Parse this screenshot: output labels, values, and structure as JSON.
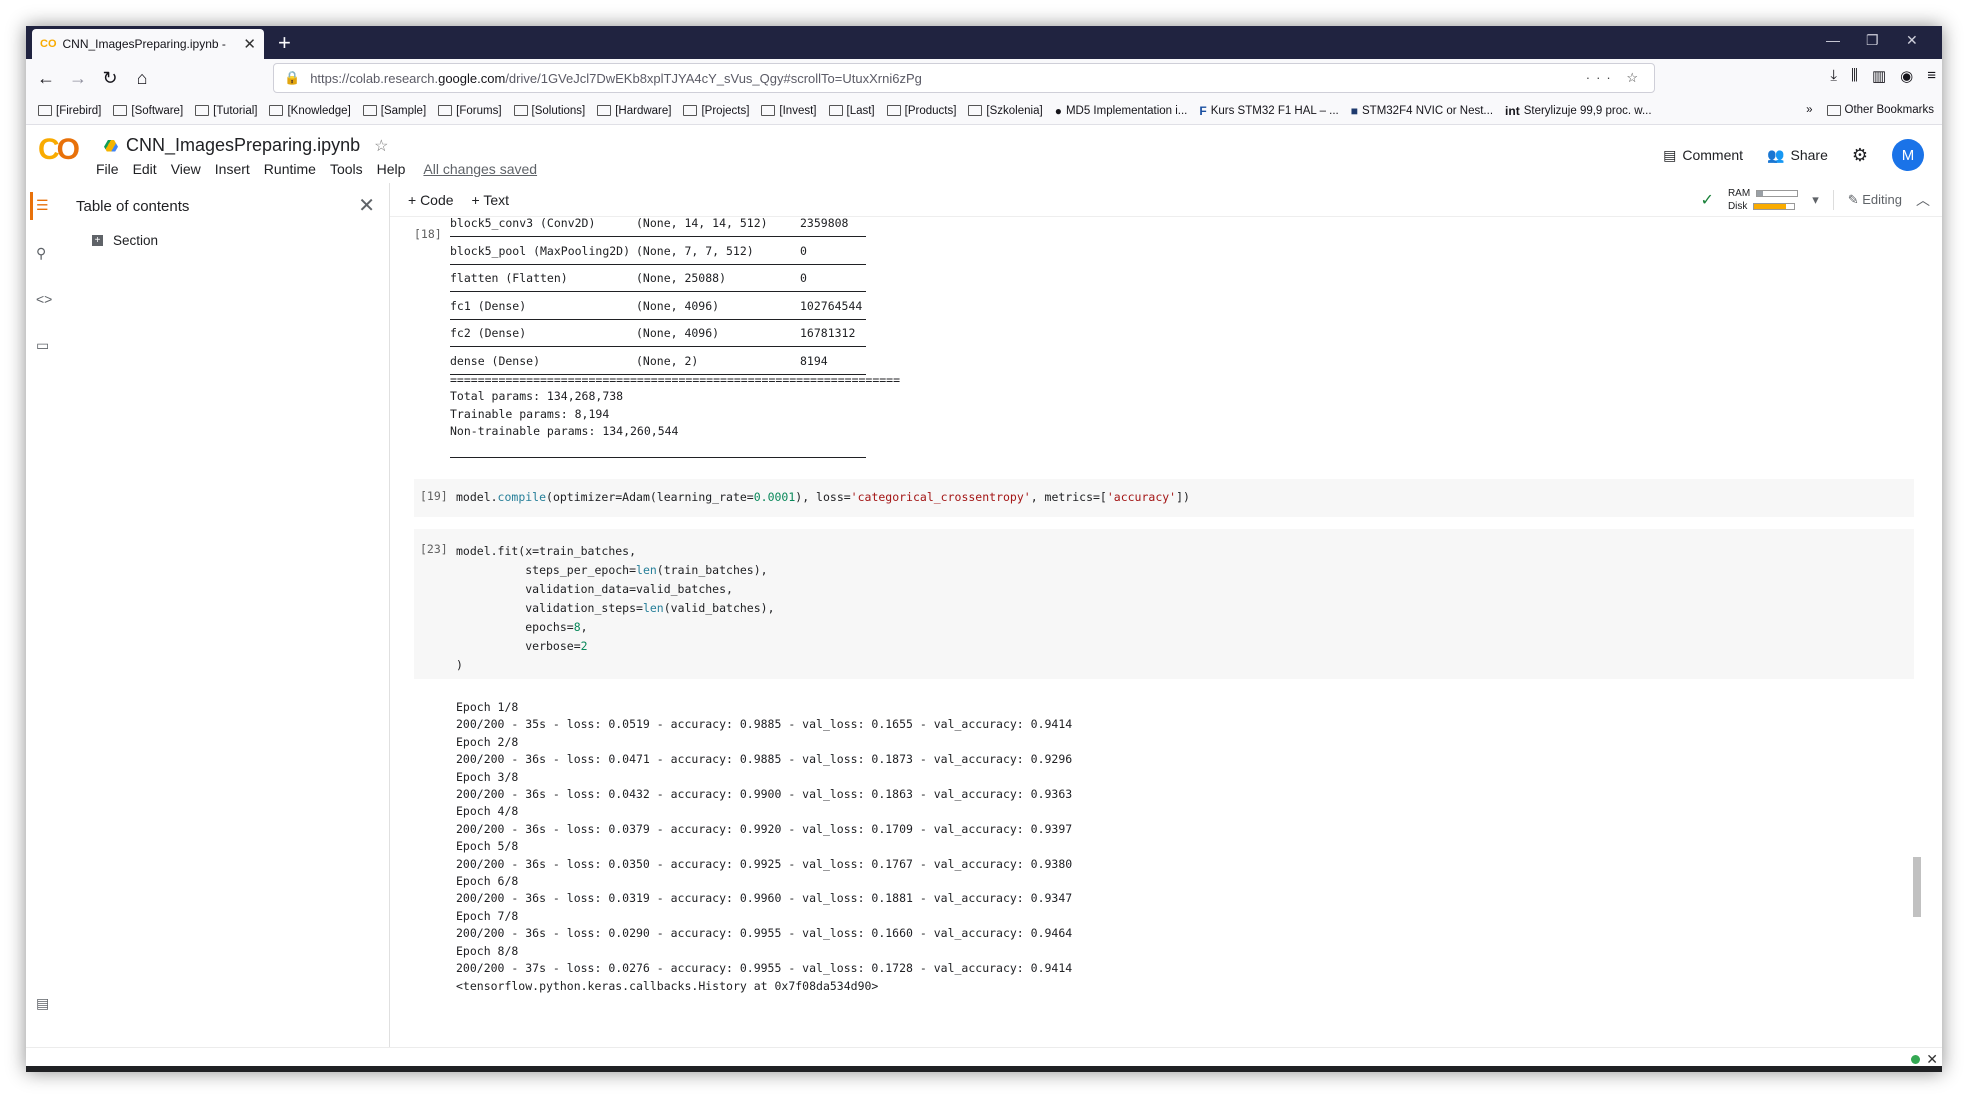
{
  "browser": {
    "tab_title": "CNN_ImagesPreparing.ipynb -",
    "tab_icon": "CO",
    "url_prefix": "https://colab.research.",
    "url_domain": "google.com",
    "url_suffix": "/drive/1GVeJcl7DwEKb8xplTJYA4cY_sVus_Qgy#scrollTo=UtuxXrni6zPg"
  },
  "bookmarks": [
    {
      "label": "[Firebird]",
      "icon": "folder"
    },
    {
      "label": "[Software]",
      "icon": "folder"
    },
    {
      "label": "[Tutorial]",
      "icon": "folder"
    },
    {
      "label": "[Knowledge]",
      "icon": "folder"
    },
    {
      "label": "[Sample]",
      "icon": "folder"
    },
    {
      "label": "[Forums]",
      "icon": "folder"
    },
    {
      "label": "[Solutions]",
      "icon": "folder"
    },
    {
      "label": "[Hardware]",
      "icon": "folder"
    },
    {
      "label": "[Projects]",
      "icon": "folder"
    },
    {
      "label": "[Invest]",
      "icon": "folder"
    },
    {
      "label": "[Last]",
      "icon": "folder"
    },
    {
      "label": "[Products]",
      "icon": "folder"
    },
    {
      "label": "[Szkolenia]",
      "icon": "folder"
    },
    {
      "label": "MD5 Implementation i...",
      "icon": "github"
    },
    {
      "label": "Kurs STM32 F1 HAL – ...",
      "icon": "f-logo"
    },
    {
      "label": "STM32F4 NVIC or Nest...",
      "icon": "site"
    },
    {
      "label": "Sterylizuje 99,9 proc. w...",
      "icon": "int"
    }
  ],
  "bookmarks_other": "Other Bookmarks",
  "colab": {
    "notebook_name": "CNN_ImagesPreparing.ipynb",
    "menus": [
      "File",
      "Edit",
      "View",
      "Insert",
      "Runtime",
      "Tools",
      "Help"
    ],
    "saved_status": "All changes saved",
    "comment_label": "Comment",
    "share_label": "Share",
    "avatar_letter": "M",
    "add_code": "+ Code",
    "add_text": "+ Text",
    "ram_label": "RAM",
    "disk_label": "Disk",
    "ram_level": 0.15,
    "disk_level": 0.8,
    "editing_label": "Editing"
  },
  "sidebar": {
    "title": "Table of contents",
    "section": "Section"
  },
  "cells": {
    "summary_exec": "[18]",
    "summary_rows": [
      {
        "layer": "block5_conv3 (Conv2D)",
        "shape": "(None, 14, 14, 512)",
        "params": "2359808"
      },
      {
        "layer": "block5_pool (MaxPooling2D)",
        "shape": "(None, 7, 7, 512)",
        "params": "0"
      },
      {
        "layer": "flatten (Flatten)",
        "shape": "(None, 25088)",
        "params": "0"
      },
      {
        "layer": "fc1 (Dense)",
        "shape": "(None, 4096)",
        "params": "102764544"
      },
      {
        "layer": "fc2 (Dense)",
        "shape": "(None, 4096)",
        "params": "16781312"
      },
      {
        "layer": "dense (Dense)",
        "shape": "(None, 2)",
        "params": "8194"
      }
    ],
    "summary_equals": "=================================================================",
    "total_params": "Total params: 134,268,738",
    "trainable_params": "Trainable params: 8,194",
    "nontrainable_params": "Non-trainable params: 134,260,544",
    "compile_exec": "[19]",
    "fit_exec": "[23]",
    "fit_output": [
      "Epoch 1/8",
      "200/200 - 35s - loss: 0.0519 - accuracy: 0.9885 - val_loss: 0.1655 - val_accuracy: 0.9414",
      "Epoch 2/8",
      "200/200 - 36s - loss: 0.0471 - accuracy: 0.9885 - val_loss: 0.1873 - val_accuracy: 0.9296",
      "Epoch 3/8",
      "200/200 - 36s - loss: 0.0432 - accuracy: 0.9900 - val_loss: 0.1863 - val_accuracy: 0.9363",
      "Epoch 4/8",
      "200/200 - 36s - loss: 0.0379 - accuracy: 0.9920 - val_loss: 0.1709 - val_accuracy: 0.9397",
      "Epoch 5/8",
      "200/200 - 36s - loss: 0.0350 - accuracy: 0.9925 - val_loss: 0.1767 - val_accuracy: 0.9380",
      "Epoch 6/8",
      "200/200 - 36s - loss: 0.0319 - accuracy: 0.9960 - val_loss: 0.1881 - val_accuracy: 0.9347",
      "Epoch 7/8",
      "200/200 - 36s - loss: 0.0290 - accuracy: 0.9955 - val_loss: 0.1660 - val_accuracy: 0.9464",
      "Epoch 8/8",
      "200/200 - 37s - loss: 0.0276 - accuracy: 0.9955 - val_loss: 0.1728 - val_accuracy: 0.9414",
      "<tensorflow.python.keras.callbacks.History at 0x7f08da534d90>"
    ]
  },
  "colors": {
    "accent": "#e8710a",
    "logo_yellow": "#f9ab00",
    "avatar": "#1a73e8",
    "tabbar": "#202340"
  }
}
